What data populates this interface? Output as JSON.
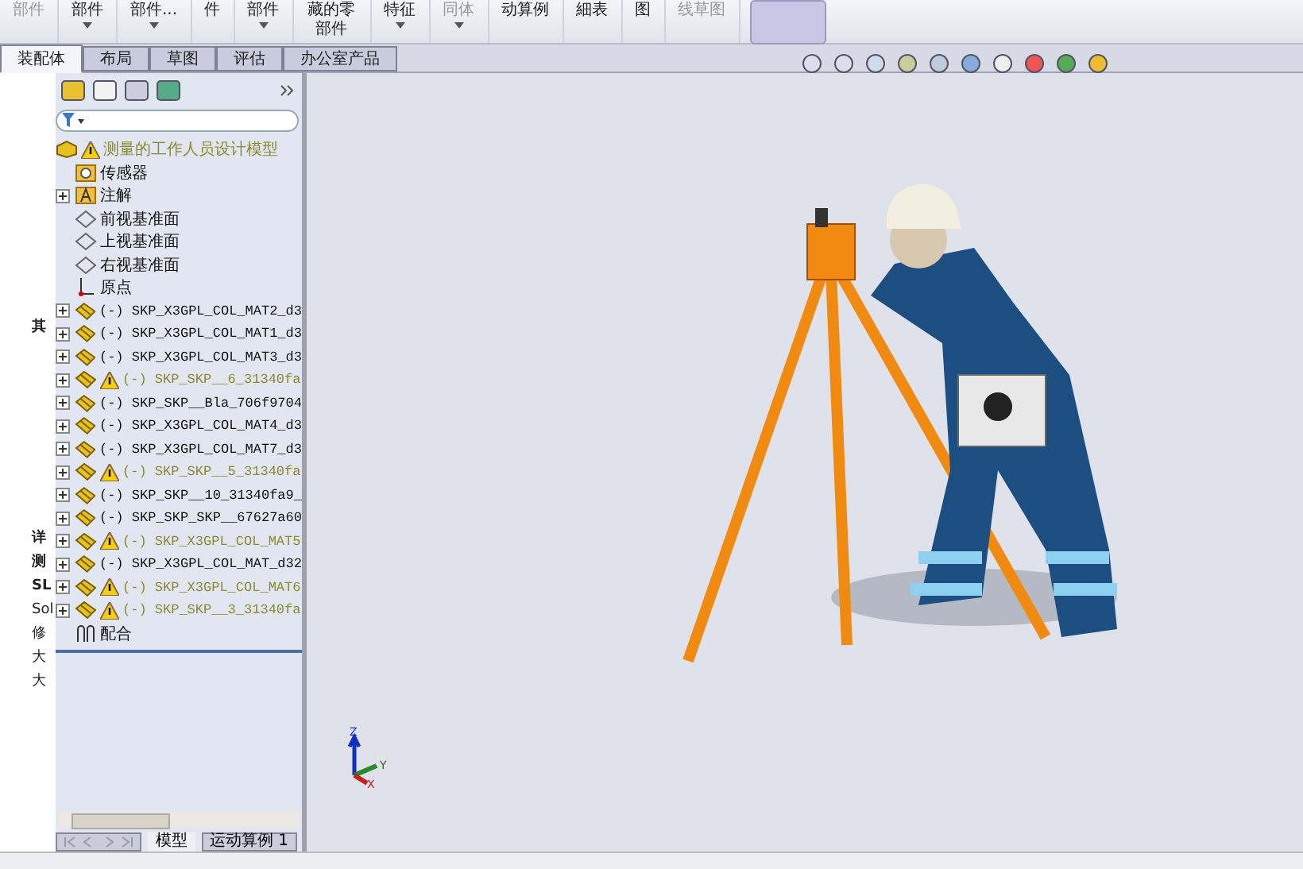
{
  "ribbon": [
    {
      "label": "部件",
      "disabled": true,
      "caret": false
    },
    {
      "label": "部件",
      "disabled": false,
      "caret": true
    },
    {
      "label": "部件...",
      "disabled": false,
      "caret": true
    },
    {
      "label": "件",
      "disabled": false,
      "caret": false
    },
    {
      "label": "部件",
      "disabled": false,
      "caret": true
    },
    {
      "label": "藏的零部件",
      "disabled": false,
      "caret": false
    },
    {
      "label": "特征",
      "disabled": false,
      "caret": true
    },
    {
      "label": "同体",
      "disabled": true,
      "caret": true
    },
    {
      "label": "动算例",
      "disabled": false,
      "caret": false
    },
    {
      "label": "細表",
      "disabled": false,
      "caret": false
    },
    {
      "label": "图",
      "disabled": false,
      "caret": false
    },
    {
      "label": "线草图",
      "disabled": true,
      "caret": false
    }
  ],
  "tabs": [
    {
      "label": "装配体",
      "selected": true
    },
    {
      "label": "布局",
      "selected": false
    },
    {
      "label": "草图",
      "selected": false
    },
    {
      "label": "评估",
      "selected": false
    },
    {
      "label": "办公室产品",
      "selected": false
    }
  ],
  "side_panel": {
    "labels": [
      "其",
      "详",
      "测",
      "SL",
      "Sol",
      "修",
      "大",
      "大"
    ]
  },
  "tree": {
    "root": {
      "label": "测量的工作人员设计模型",
      "warning": true
    },
    "items": [
      {
        "kind": "sensor",
        "label": "传感器",
        "expandable": false,
        "warning": false
      },
      {
        "kind": "annotation",
        "label": "注解",
        "expandable": true,
        "warning": false
      },
      {
        "kind": "plane",
        "label": "前视基准面",
        "expandable": false,
        "warning": false
      },
      {
        "kind": "plane",
        "label": "上视基准面",
        "expandable": false,
        "warning": false
      },
      {
        "kind": "plane",
        "label": "右视基准面",
        "expandable": false,
        "warning": false
      },
      {
        "kind": "origin",
        "label": "原点",
        "expandable": false,
        "warning": false
      },
      {
        "kind": "part",
        "label": "(-) SKP_X3GPL_COL_MAT2_d3",
        "expandable": true,
        "warning": false
      },
      {
        "kind": "part",
        "label": "(-) SKP_X3GPL_COL_MAT1_d3",
        "expandable": true,
        "warning": false
      },
      {
        "kind": "part",
        "label": "(-) SKP_X3GPL_COL_MAT3_d3",
        "expandable": true,
        "warning": false
      },
      {
        "kind": "part",
        "label": "(-) SKP_SKP__6_31340fa",
        "expandable": true,
        "warning": true
      },
      {
        "kind": "part",
        "label": "(-) SKP_SKP__Bla_706f9704",
        "expandable": true,
        "warning": false
      },
      {
        "kind": "part",
        "label": "(-) SKP_X3GPL_COL_MAT4_d3",
        "expandable": true,
        "warning": false
      },
      {
        "kind": "part",
        "label": "(-) SKP_X3GPL_COL_MAT7_d3",
        "expandable": true,
        "warning": false
      },
      {
        "kind": "part",
        "label": "(-) SKP_SKP__5_31340fa",
        "expandable": true,
        "warning": true
      },
      {
        "kind": "part",
        "label": "(-) SKP_SKP__10_31340fa9_",
        "expandable": true,
        "warning": false
      },
      {
        "kind": "part",
        "label": "(-) SKP_SKP_SKP__67627a60",
        "expandable": true,
        "warning": false
      },
      {
        "kind": "part",
        "label": "(-) SKP_X3GPL_COL_MAT5",
        "expandable": true,
        "warning": true
      },
      {
        "kind": "part",
        "label": "(-) SKP_X3GPL_COL_MAT_d32",
        "expandable": true,
        "warning": false
      },
      {
        "kind": "part",
        "label": "(-) SKP_X3GPL_COL_MAT6",
        "expandable": true,
        "warning": true
      },
      {
        "kind": "part",
        "label": "(-) SKP_SKP__3_31340fa",
        "expandable": true,
        "warning": true
      },
      {
        "kind": "mates",
        "label": "配合",
        "expandable": false,
        "warning": false
      }
    ]
  },
  "bottom_tabs": [
    {
      "label": "模型",
      "selected": true
    },
    {
      "label": "运动算例 1",
      "selected": false
    }
  ],
  "triad": {
    "axes": [
      "Z",
      "Y",
      "X"
    ]
  }
}
